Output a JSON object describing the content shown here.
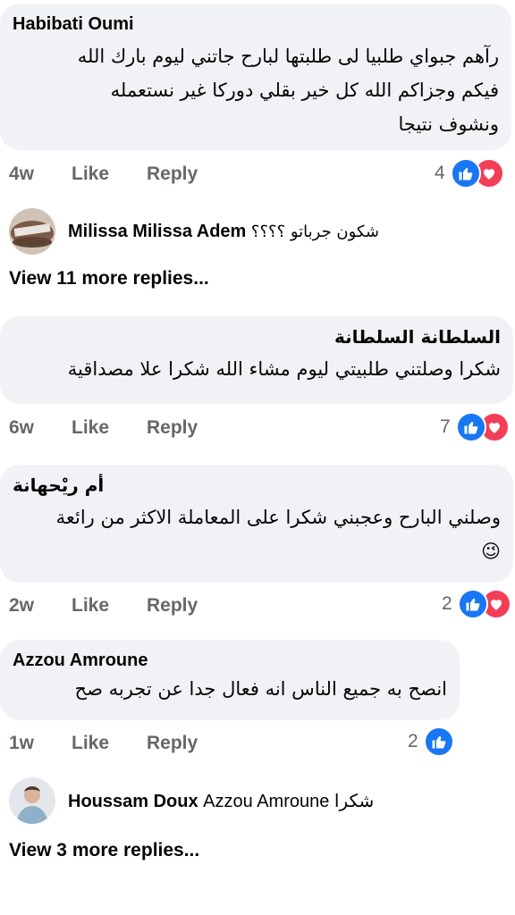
{
  "comments": [
    {
      "author": "Habibati Oumi",
      "lines": [
        "رآهم جبواي طلبيا لى طلبتها لبارح جاتني ليوم   بارك الله",
        "فيكم وجزاكم الله كل خير بقلي دوركا غير نستعمله",
        "ونشوف نتيجا"
      ],
      "time": "4w",
      "like": "Like",
      "reply": "Reply",
      "reactions": "4",
      "reaction_icons": [
        "like-icon",
        "love-icon"
      ]
    },
    {
      "author": "السلطانة السلطانة",
      "lines": [
        "شكرا وصلتني طلبيتي ليوم مشاء الله شكرا علا مصداقية"
      ],
      "time": "6w",
      "like": "Like",
      "reply": "Reply",
      "reactions": "7",
      "reaction_icons": [
        "like-icon",
        "love-icon"
      ]
    },
    {
      "author": "أم ريْحهانة",
      "lines": [
        "وصلني البارح وعجبني شكرا على المعاملة الاكثر من رائعة",
        "😉"
      ],
      "time": "2w",
      "like": "Like",
      "reply": "Reply",
      "reactions": "2",
      "reaction_icons": [
        "like-icon",
        "love-icon"
      ]
    },
    {
      "author": "Azzou Amroune",
      "lines": [
        "انصح به جميع الناس انه فعال جدا عن تجربه صح"
      ],
      "time": "1w",
      "like": "Like",
      "reply": "Reply",
      "reactions": "2",
      "reaction_icons": [
        "like-icon"
      ]
    }
  ],
  "replies": [
    {
      "author": "Milissa Milissa Adem",
      "text": "شكون جرباتو ؟؟؟؟"
    },
    {
      "author": "Houssam Doux",
      "text": "Azzou Amroune شكرا"
    }
  ],
  "view_more": [
    "View 11 more replies...",
    "View 3 more replies..."
  ],
  "colors": {
    "bubble": "#f0f2f5",
    "like_blue": "#1877f2",
    "love_red": "#f33e58",
    "meta_gray": "#65676b"
  }
}
